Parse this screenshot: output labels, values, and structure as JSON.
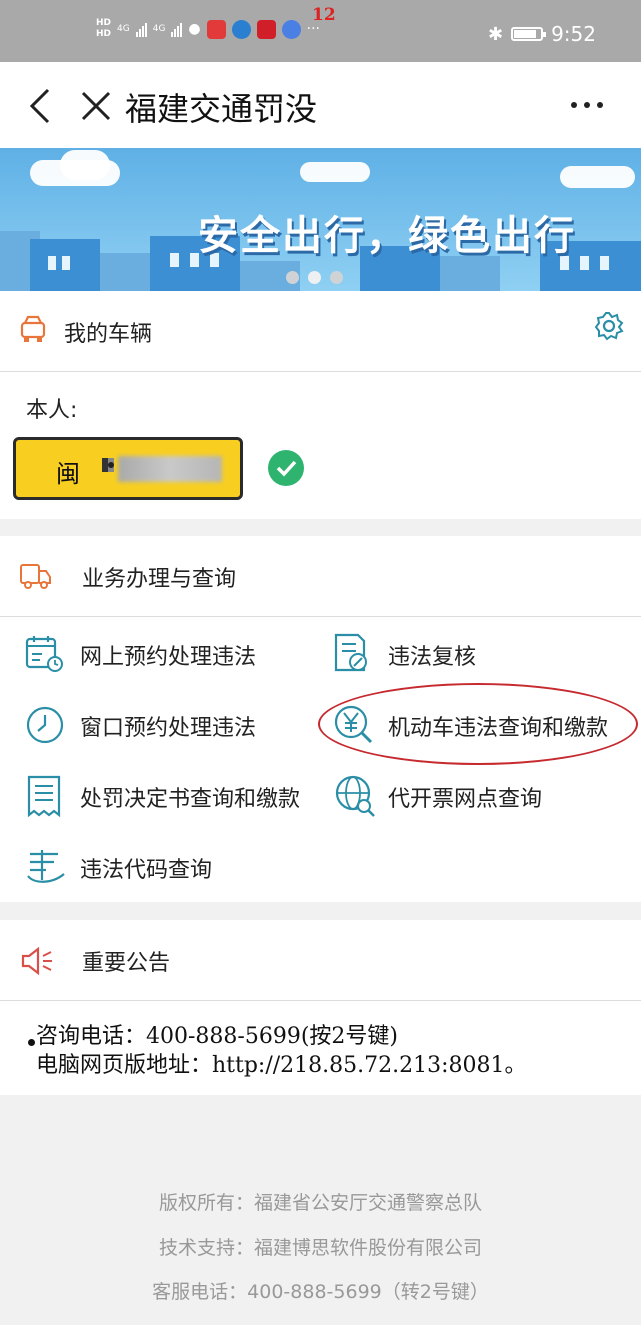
{
  "status_bar": {
    "hd1": "HD",
    "hd2": "HD",
    "net1": "4G",
    "net2": "4G",
    "notification_count": "12",
    "more": "···",
    "time": "9:52"
  },
  "titlebar": {
    "title": "福建交通罚没"
  },
  "banner": {
    "text": "安全出行，绿色出行",
    "slide_count": 3,
    "active_slide": 2
  },
  "vehicles": {
    "heading": "我的车辆",
    "owner_label": "本人:",
    "plate_prefix": "闽",
    "plate_color": "#f8cf21",
    "verified_color": "#2fb46f"
  },
  "services": {
    "heading": "业务办理与查询",
    "items": [
      {
        "label": "网上预约处理违法",
        "icon": "calendar-clock-icon"
      },
      {
        "label": "违法复核",
        "icon": "document-edit-icon"
      },
      {
        "label": "窗口预约处理违法",
        "icon": "clock-icon"
      },
      {
        "label": "机动车违法查询和缴款",
        "icon": "yen-search-icon"
      },
      {
        "label": "处罚决定书查询和缴款",
        "icon": "receipt-icon"
      },
      {
        "label": "代开票网点查询",
        "icon": "globe-search-icon"
      },
      {
        "label": "违法代码查询",
        "icon": "code-list-icon"
      }
    ]
  },
  "announcement": {
    "heading": "重要公告",
    "line1": "咨询电话：400-888-5699(按2号键)",
    "line2": "电脑网页版地址：http://218.85.72.213:8081。"
  },
  "footer": {
    "copyright": "版权所有：福建省公安厅交通警察总队",
    "support": "技术支持：福建博思软件股份有限公司",
    "hotline": "客服电话：400-888-5699（转2号键）"
  },
  "colors": {
    "accent_orange": "#e8763a",
    "accent_teal": "#2a8fa6",
    "highlight_red": "#c62a2f"
  }
}
